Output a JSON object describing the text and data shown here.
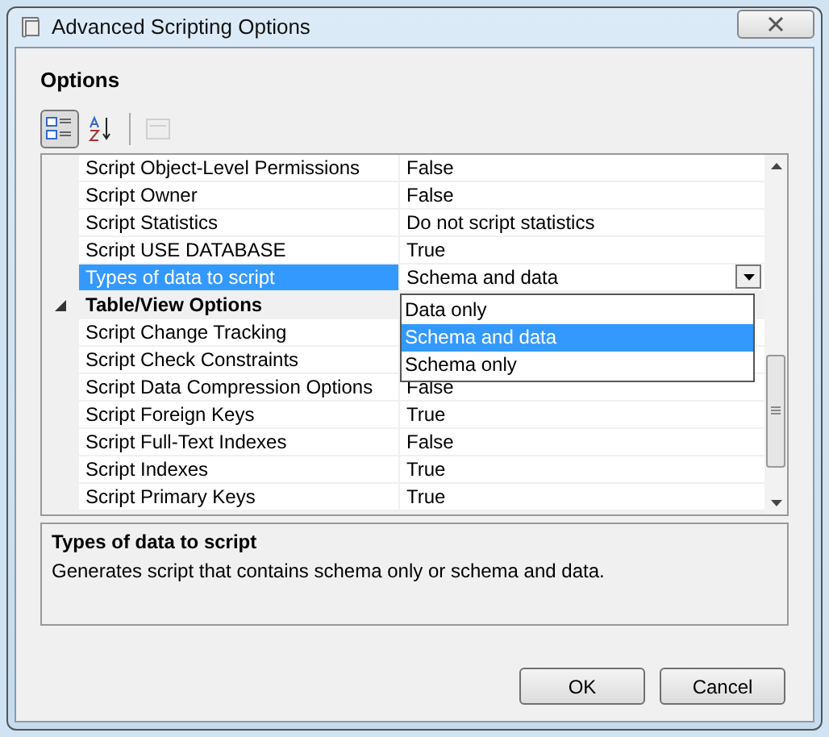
{
  "window": {
    "title": "Advanced Scripting Options"
  },
  "section_title": "Options",
  "toolbar": [
    {
      "kind": "categorized",
      "selected": true
    },
    {
      "kind": "alphabetical",
      "selected": false
    },
    {
      "kind": "pages",
      "selected": false,
      "disabled": true
    }
  ],
  "property_grid": {
    "rows": [
      {
        "kind": "property",
        "name": "Script Object-Level Permissions",
        "value": "False",
        "selected": false
      },
      {
        "kind": "property",
        "name": "Script Owner",
        "value": "False",
        "selected": false
      },
      {
        "kind": "property",
        "name": "Script Statistics",
        "value": "Do not script statistics",
        "selected": false
      },
      {
        "kind": "property",
        "name": "Script USE DATABASE",
        "value": "True",
        "selected": false
      },
      {
        "kind": "property",
        "name": "Types of data to script",
        "value": "Schema and data",
        "selected": true
      },
      {
        "kind": "category",
        "name": "Table/View Options",
        "expanded": true
      },
      {
        "kind": "property",
        "name": "Script Change Tracking",
        "selected": false
      },
      {
        "kind": "property",
        "name": "Script Check Constraints",
        "selected": false
      },
      {
        "kind": "property",
        "name": "Script Data Compression Options",
        "value": "False",
        "selected": false
      },
      {
        "kind": "property",
        "name": "Script Foreign Keys",
        "value": "True",
        "selected": false
      },
      {
        "kind": "property",
        "name": "Script Full-Text Indexes",
        "value": "False",
        "selected": false
      },
      {
        "kind": "property",
        "name": "Script Indexes",
        "value": "True",
        "selected": false
      },
      {
        "kind": "property",
        "name": "Script Primary Keys",
        "value": "True",
        "selected": false
      }
    ],
    "dropdown": {
      "options": [
        {
          "label": "Data only",
          "selected": false
        },
        {
          "label": "Schema and data",
          "selected": true
        },
        {
          "label": "Schema only",
          "selected": false
        }
      ]
    }
  },
  "description": {
    "title": "Types of data to script",
    "text": "Generates script that contains schema only or schema and data."
  },
  "buttons": [
    "OK",
    "Cancel"
  ]
}
